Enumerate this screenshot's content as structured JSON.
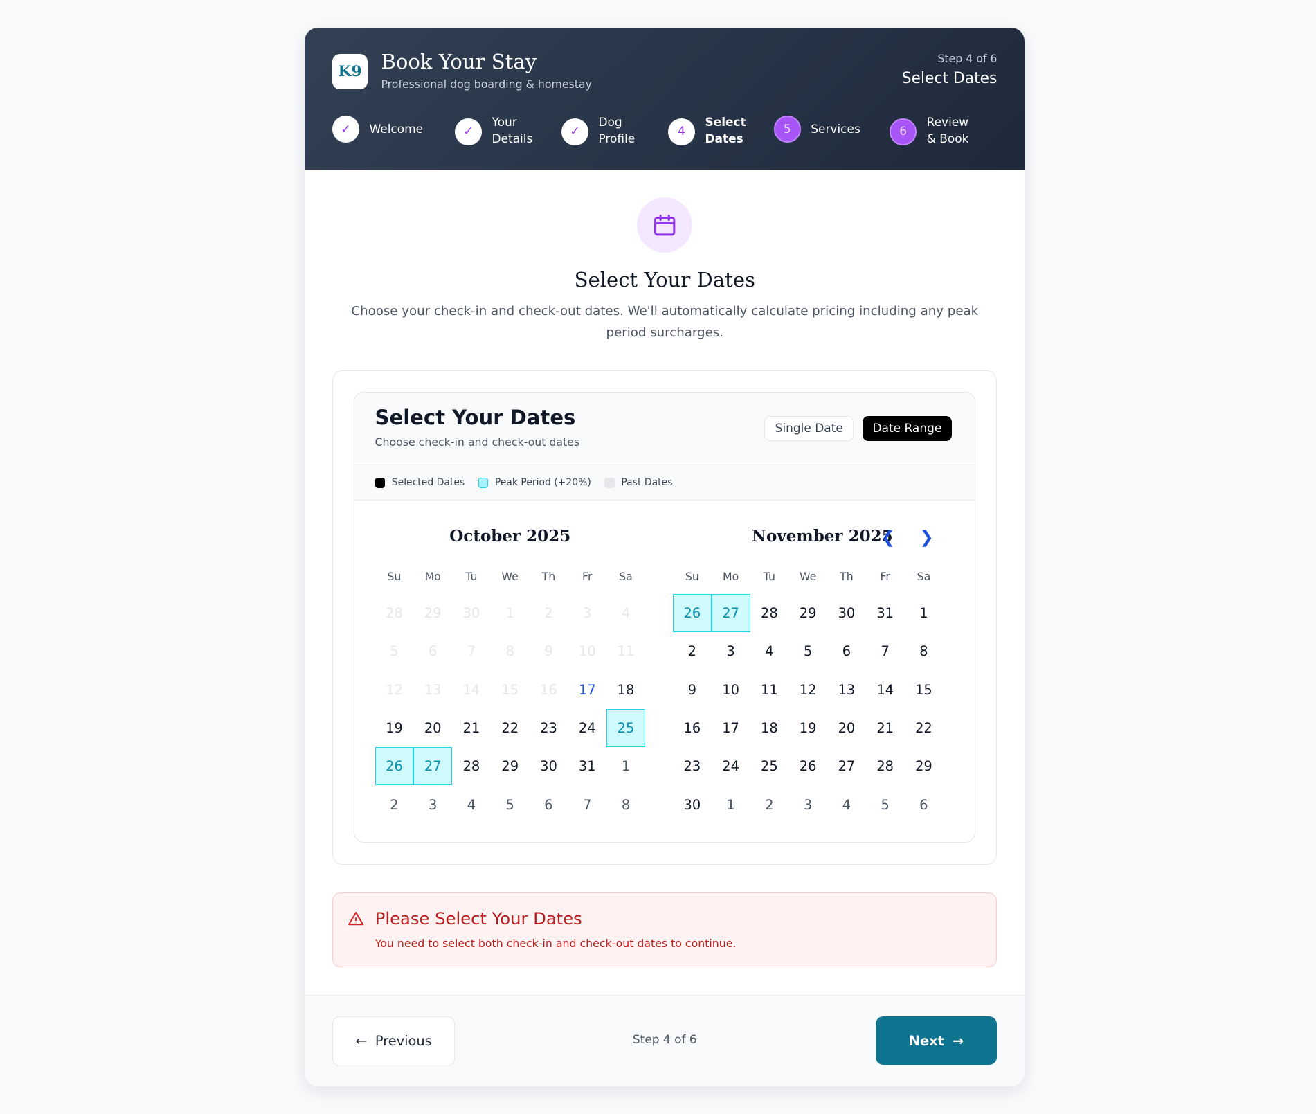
{
  "header": {
    "logo": "K9",
    "title": "Book Your Stay",
    "subtitle": "Professional dog boarding & homestay",
    "step_label": "Step 4 of 6",
    "step_name": "Select Dates"
  },
  "steps": [
    {
      "marker": "✓",
      "label": "Welcome",
      "state": "done"
    },
    {
      "marker": "✓",
      "label": "Your Details",
      "state": "done"
    },
    {
      "marker": "✓",
      "label": "Dog Profile",
      "state": "done"
    },
    {
      "marker": "4",
      "label": "Select Dates",
      "state": "current"
    },
    {
      "marker": "5",
      "label": "Services",
      "state": "upcoming"
    },
    {
      "marker": "6",
      "label": "Review & Book",
      "state": "upcoming"
    }
  ],
  "intro": {
    "icon": "calendar-icon",
    "title": "Select Your Dates",
    "description": "Choose your check-in and check-out dates. We'll automatically calculate pricing including any peak period surcharges."
  },
  "picker": {
    "title": "Select Your Dates",
    "subtitle": "Choose check-in and check-out dates",
    "mode_single": "Single Date",
    "mode_range": "Date Range",
    "active_mode": "Date Range",
    "legend": [
      {
        "label": "Selected Dates",
        "color": "#000000"
      },
      {
        "label": "Peak Period (+20%)",
        "color": "#a5f3fc"
      },
      {
        "label": "Past Dates",
        "color": "#e5e7eb"
      }
    ],
    "weekdays": [
      "Su",
      "Mo",
      "Tu",
      "We",
      "Th",
      "Fr",
      "Sa"
    ],
    "months": [
      {
        "title": "October 2025",
        "days": [
          [
            "28",
            "past"
          ],
          [
            "29",
            "past"
          ],
          [
            "30",
            "past"
          ],
          [
            "1",
            "past"
          ],
          [
            "2",
            "past"
          ],
          [
            "3",
            "past"
          ],
          [
            "4",
            "past"
          ],
          [
            "5",
            "past"
          ],
          [
            "6",
            "past"
          ],
          [
            "7",
            "past"
          ],
          [
            "8",
            "past"
          ],
          [
            "9",
            "past"
          ],
          [
            "10",
            "past"
          ],
          [
            "11",
            "past"
          ],
          [
            "12",
            "past"
          ],
          [
            "13",
            "past"
          ],
          [
            "14",
            "past"
          ],
          [
            "15",
            "past"
          ],
          [
            "16",
            "past"
          ],
          [
            "17",
            "today"
          ],
          [
            "18",
            ""
          ],
          [
            "19",
            ""
          ],
          [
            "20",
            ""
          ],
          [
            "21",
            ""
          ],
          [
            "22",
            ""
          ],
          [
            "23",
            ""
          ],
          [
            "24",
            ""
          ],
          [
            "25",
            "peak"
          ],
          [
            "26",
            "peak"
          ],
          [
            "27",
            "peak"
          ],
          [
            "28",
            ""
          ],
          [
            "29",
            ""
          ],
          [
            "30",
            ""
          ],
          [
            "31",
            ""
          ],
          [
            "1",
            "out"
          ],
          [
            "2",
            "out"
          ],
          [
            "3",
            "out"
          ],
          [
            "4",
            "out"
          ],
          [
            "5",
            "out"
          ],
          [
            "6",
            "out"
          ],
          [
            "7",
            "out"
          ],
          [
            "8",
            "out"
          ]
        ]
      },
      {
        "title": "November 2025",
        "days": [
          [
            "26",
            "peak"
          ],
          [
            "27",
            "peak"
          ],
          [
            "28",
            ""
          ],
          [
            "29",
            ""
          ],
          [
            "30",
            ""
          ],
          [
            "31",
            ""
          ],
          [
            "1",
            ""
          ],
          [
            "2",
            ""
          ],
          [
            "3",
            ""
          ],
          [
            "4",
            ""
          ],
          [
            "5",
            ""
          ],
          [
            "6",
            ""
          ],
          [
            "7",
            ""
          ],
          [
            "8",
            ""
          ],
          [
            "9",
            ""
          ],
          [
            "10",
            ""
          ],
          [
            "11",
            ""
          ],
          [
            "12",
            ""
          ],
          [
            "13",
            ""
          ],
          [
            "14",
            ""
          ],
          [
            "15",
            ""
          ],
          [
            "16",
            ""
          ],
          [
            "17",
            ""
          ],
          [
            "18",
            ""
          ],
          [
            "19",
            ""
          ],
          [
            "20",
            ""
          ],
          [
            "21",
            ""
          ],
          [
            "22",
            ""
          ],
          [
            "23",
            ""
          ],
          [
            "24",
            ""
          ],
          [
            "25",
            ""
          ],
          [
            "26",
            ""
          ],
          [
            "27",
            ""
          ],
          [
            "28",
            ""
          ],
          [
            "29",
            ""
          ],
          [
            "30",
            ""
          ],
          [
            "1",
            "out"
          ],
          [
            "2",
            "out"
          ],
          [
            "3",
            "out"
          ],
          [
            "4",
            "out"
          ],
          [
            "5",
            "out"
          ],
          [
            "6",
            "out"
          ]
        ]
      }
    ]
  },
  "alert": {
    "title": "Please Select Your Dates",
    "message": "You need to select both check-in and check-out dates to continue."
  },
  "footer": {
    "previous": "Previous",
    "step": "Step 4 of 6",
    "next": "Next"
  },
  "colors": {
    "accent": "#0e7490",
    "purple": "#a855f7",
    "header": "#1e293b"
  }
}
